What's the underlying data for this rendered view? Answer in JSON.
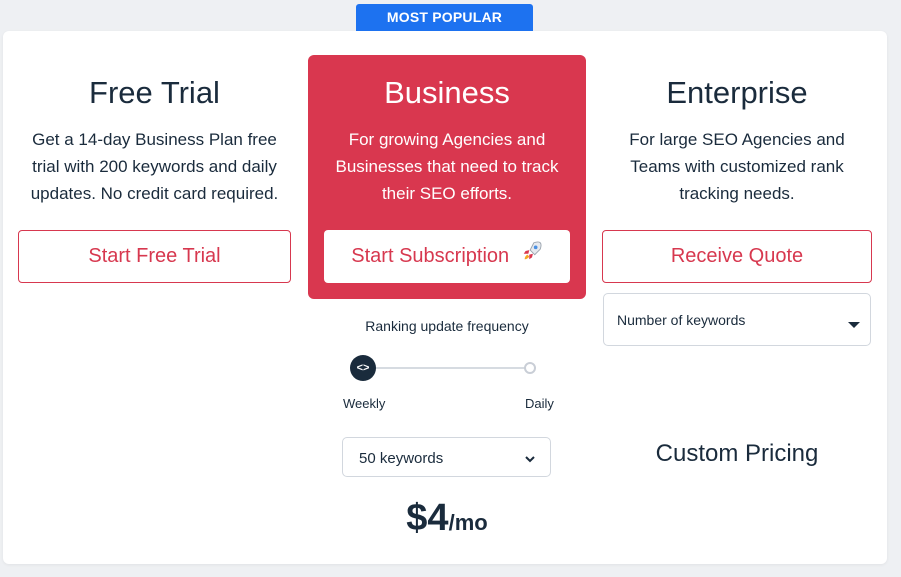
{
  "badge": "MOST POPULAR",
  "plans": {
    "free": {
      "title": "Free Trial",
      "description": "Get a 14-day Business Plan free trial with 200 keywords and daily updates. No credit card required.",
      "button": "Start Free Trial"
    },
    "business": {
      "title": "Business",
      "description": "For growing Agencies and Businesses that need to track their SEO efforts.",
      "button": "Start Subscription",
      "button_icon": "rocket-icon",
      "frequency_label": "Ranking update frequency",
      "frequency_options": [
        "Weekly",
        "Daily"
      ],
      "frequency_selected": "Weekly",
      "keywords_select": "50 keywords",
      "price_amount": "$4",
      "price_period": "/mo"
    },
    "enterprise": {
      "title": "Enterprise",
      "description": "For large SEO Agencies and Teams with customized rank tracking needs.",
      "button": "Receive Quote",
      "keywords_select": "Number of keywords",
      "custom_pricing": "Custom Pricing"
    }
  },
  "colors": {
    "accent_red": "#d9374f",
    "badge_blue": "#1d72f0",
    "text_dark": "#1a2b3c"
  }
}
